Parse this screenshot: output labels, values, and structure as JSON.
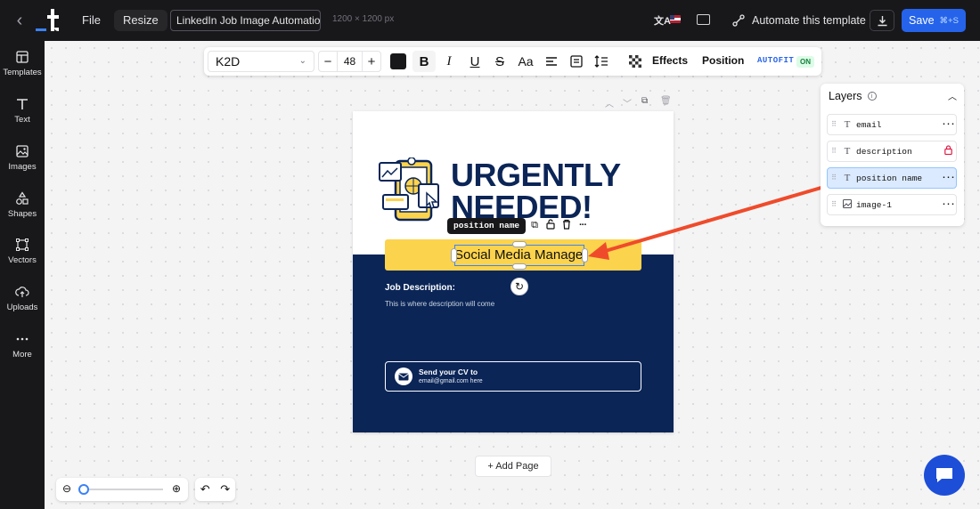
{
  "topbar": {
    "file_label": "File",
    "resize_label": "Resize",
    "document_title": "LinkedIn Job Image Automation",
    "dimensions": "1200 × 1200 px",
    "automate_label": "Automate this template",
    "save_label": "Save",
    "save_shortcut": "⌘+S"
  },
  "sidebar": {
    "items": [
      {
        "label": "Templates",
        "icon": "templates-icon"
      },
      {
        "label": "Text",
        "icon": "text-icon"
      },
      {
        "label": "Images",
        "icon": "image-icon"
      },
      {
        "label": "Shapes",
        "icon": "shapes-icon"
      },
      {
        "label": "Vectors",
        "icon": "vector-icon"
      },
      {
        "label": "Uploads",
        "icon": "upload-icon"
      },
      {
        "label": "More",
        "icon": "more-icon"
      }
    ]
  },
  "toolbar": {
    "font": "K2D",
    "font_size": "48",
    "minus": "−",
    "plus": "+",
    "text_color": "#18181b",
    "effects_label": "Effects",
    "position_label": "Position",
    "autofit_label": "AUTOFIT",
    "autofit_state": "ON"
  },
  "design": {
    "headline_line1": "URGENTLY",
    "headline_line2": "NEEDED!",
    "position_name": "Social Media Manager",
    "selection_label": "position name",
    "job_description_title": "Job Description:",
    "job_description_body": "This is where description will come",
    "cv_title": "Send your CV to",
    "cv_email": "email@gmail.com here",
    "colors": {
      "navy": "#0b2557",
      "yellow": "#fcd34d"
    }
  },
  "add_page_label": "+ Add Page",
  "layers": {
    "title": "Layers",
    "items": [
      {
        "name": "email",
        "type": "text",
        "locked": false,
        "active": false
      },
      {
        "name": "description",
        "type": "text",
        "locked": true,
        "active": false
      },
      {
        "name": "position name",
        "type": "text",
        "locked": false,
        "active": true
      },
      {
        "name": "image-1",
        "type": "image",
        "locked": false,
        "active": false
      }
    ]
  },
  "zoom": {
    "level_fraction": 0.05
  },
  "accent_color": "#2563eb",
  "annotation_arrow_color": "#ef4b2b"
}
